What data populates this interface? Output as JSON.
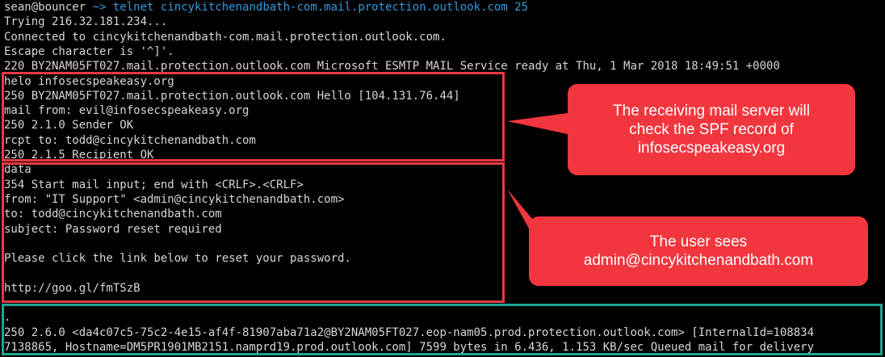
{
  "prompt": {
    "user": "sean@bouncer",
    "path_symbol": "~>",
    "command": "telnet cincykitchenandbath-com.mail.protection.outlook.com 25"
  },
  "lines": [
    "Trying 216.32.181.234...",
    "Connected to cincykitchenandbath-com.mail.protection.outlook.com.",
    "Escape character is '^]'.",
    "220 BY2NAM05FT027.mail.protection.outlook.com Microsoft ESMTP MAIL Service ready at Thu, 1 Mar 2018 18:49:51 +0000",
    "helo infosecspeakeasy.org",
    "250 BY2NAM05FT027.mail.protection.outlook.com Hello [104.131.76.44]",
    "mail from: evil@infosecspeakeasy.org",
    "250 2.1.0 Sender OK",
    "rcpt to: todd@cincykitchenandbath.com",
    "250 2.1.5 Recipient OK",
    "data",
    "354 Start mail input; end with <CRLF>.<CRLF>",
    "from: \"IT Support\" <admin@cincykitchenandbath.com>",
    "to: todd@cincykitchenandbath.com",
    "subject: Password reset required",
    "",
    "Please click the link below to reset your password.",
    "",
    "http://goo.gl/fmTSzB",
    "",
    "",
    ".",
    "250 2.6.0 <da4c07c5-75c2-4e15-af4f-81907aba71a2@BY2NAM05FT027.eop-nam05.prod.protection.outlook.com> [InternalId=108834",
    "7138865, Hostname=DM5PR1901MB2151.namprd19.prod.outlook.com] 7599 bytes in 6.436, 1.153 KB/sec Queued mail for delivery"
  ],
  "callouts": {
    "spf": "The receiving mail server will\ncheck the SPF record of\ninfosecspeakeasy.org",
    "user_sees": "The user sees\nadmin@cincykitchenandbath.com"
  },
  "colors": {
    "red_box": "#e83a42",
    "teal_box": "#1ea592",
    "callout_bg": "#f2363e",
    "command": "#2f9be0"
  }
}
